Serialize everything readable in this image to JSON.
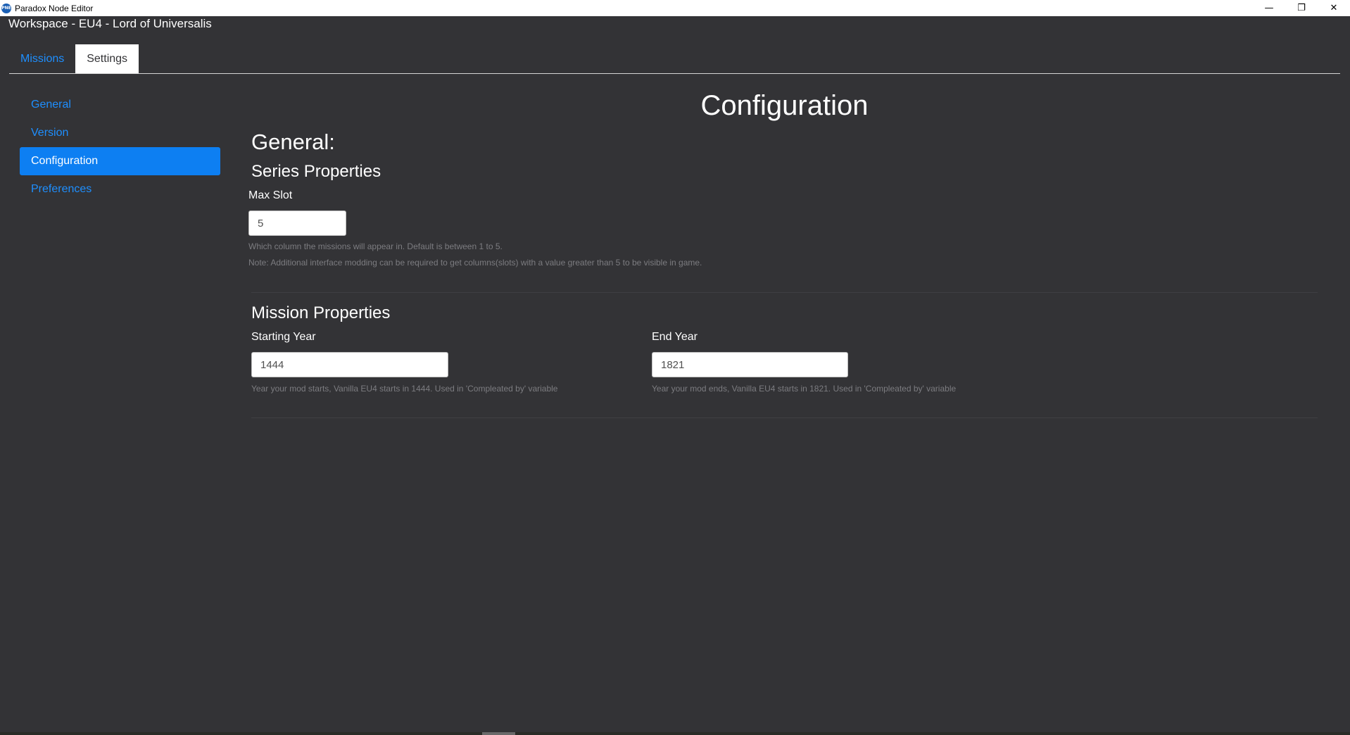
{
  "window": {
    "title": "Paradox Node Editor",
    "icon_label": "PNE",
    "minimize_glyph": "—",
    "maximize_glyph": "❐",
    "close_glyph": "✕"
  },
  "header": {
    "workspace_title": "Workspace - EU4 - Lord of Universalis"
  },
  "tabs": [
    {
      "label": "Missions",
      "active": false
    },
    {
      "label": "Settings",
      "active": true
    }
  ],
  "sidebar": {
    "items": [
      {
        "label": "General",
        "active": false
      },
      {
        "label": "Version",
        "active": false
      },
      {
        "label": "Configuration",
        "active": true
      },
      {
        "label": "Preferences",
        "active": false
      }
    ]
  },
  "main": {
    "page_title": "Configuration",
    "section_title": "General:",
    "series": {
      "heading": "Series Properties",
      "max_slot_label": "Max Slot",
      "max_slot_value": "5",
      "hint_1": "Which column the missions will appear in. Default is between 1 to 5.",
      "hint_2": "Note: Additional interface modding can be required to get columns(slots) with a value greater than 5 to be visible in game."
    },
    "mission": {
      "heading": "Mission Properties",
      "start_label": "Starting Year",
      "start_value": "1444",
      "start_hint": "Year your mod starts, Vanilla EU4 starts in 1444. Used in 'Compleated by' variable",
      "end_label": "End Year",
      "end_value": "1821",
      "end_hint": "Year your mod ends, Vanilla EU4 starts in 1821. Used in 'Compleated by' variable"
    }
  },
  "colors": {
    "background": "#333336",
    "accent": "#0d7ff2",
    "link": "#1e8fff"
  }
}
